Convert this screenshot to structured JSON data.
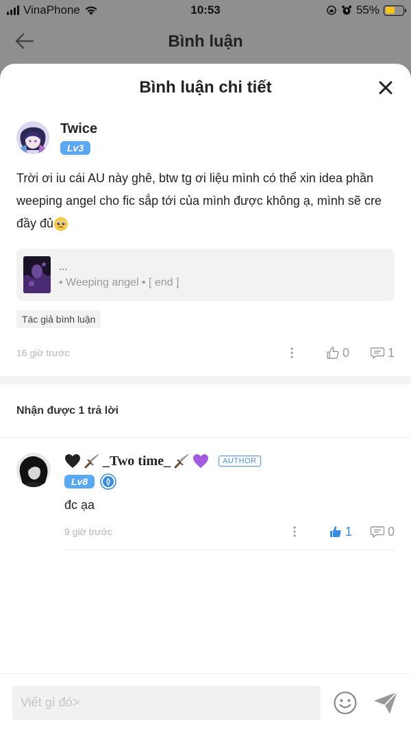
{
  "status_bar": {
    "carrier": "VinaPhone",
    "time": "10:53",
    "battery": "55%",
    "battery_level": 0.55
  },
  "nav": {
    "title": "Bình luận"
  },
  "sheet": {
    "title": "Bình luận chi tiết"
  },
  "comment": {
    "username": "Twice",
    "level": "Lv3",
    "text": "Trời ơi iu cái AU này ghê, btw tg ơi liệu mình có thể xin idea phần weeping angel cho fic sắp tới của mình được không ạ, mình sẽ cre đầy đủ",
    "story": {
      "title": "...",
      "subtitle": "• Weeping angel • [ end ]"
    },
    "tag": "Tác giả bình luận",
    "time": "16 giờ trước",
    "likes": "0",
    "replies": "1"
  },
  "replies_header": "Nhận được 1 trả lời",
  "reply": {
    "username": "_Two time_",
    "author_badge": "AUTHOR",
    "level": "Lv8",
    "text": "đc ạa",
    "time": "9 giờ trước",
    "likes": "1",
    "replies": "0"
  },
  "input": {
    "placeholder": "Viết gì đó>"
  },
  "colors": {
    "accent": "#5aa8f0",
    "like_active": "#3b8de0",
    "battery": "#f5c518"
  }
}
